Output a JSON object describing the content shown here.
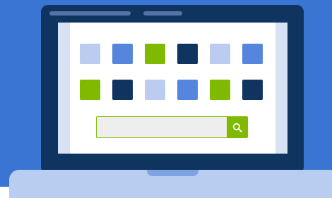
{
  "colors": {
    "background": "#3a75d4",
    "lid": "#0f3460",
    "top_bar": "#5574a3",
    "screen": "#ffffff",
    "screen_margin": "#d8e2f5",
    "base": "#b9cdf0",
    "notch": "#7ea3e3",
    "search_accent": "#7fba00",
    "search_field": "#eeeeee"
  },
  "tiles": [
    {
      "color": "#bccbf0"
    },
    {
      "color": "#5585dc"
    },
    {
      "color": "#7fba00"
    },
    {
      "color": "#0f3460"
    },
    {
      "color": "#bccbf0"
    },
    {
      "color": "#5585dc"
    },
    {
      "color": "#7fba00"
    },
    {
      "color": "#0f3460"
    },
    {
      "color": "#bccbf0"
    },
    {
      "color": "#5585dc"
    },
    {
      "color": "#7fba00"
    },
    {
      "color": "#0f3460"
    }
  ],
  "search": {
    "value": "",
    "placeholder": "",
    "button_icon": "search-icon"
  }
}
